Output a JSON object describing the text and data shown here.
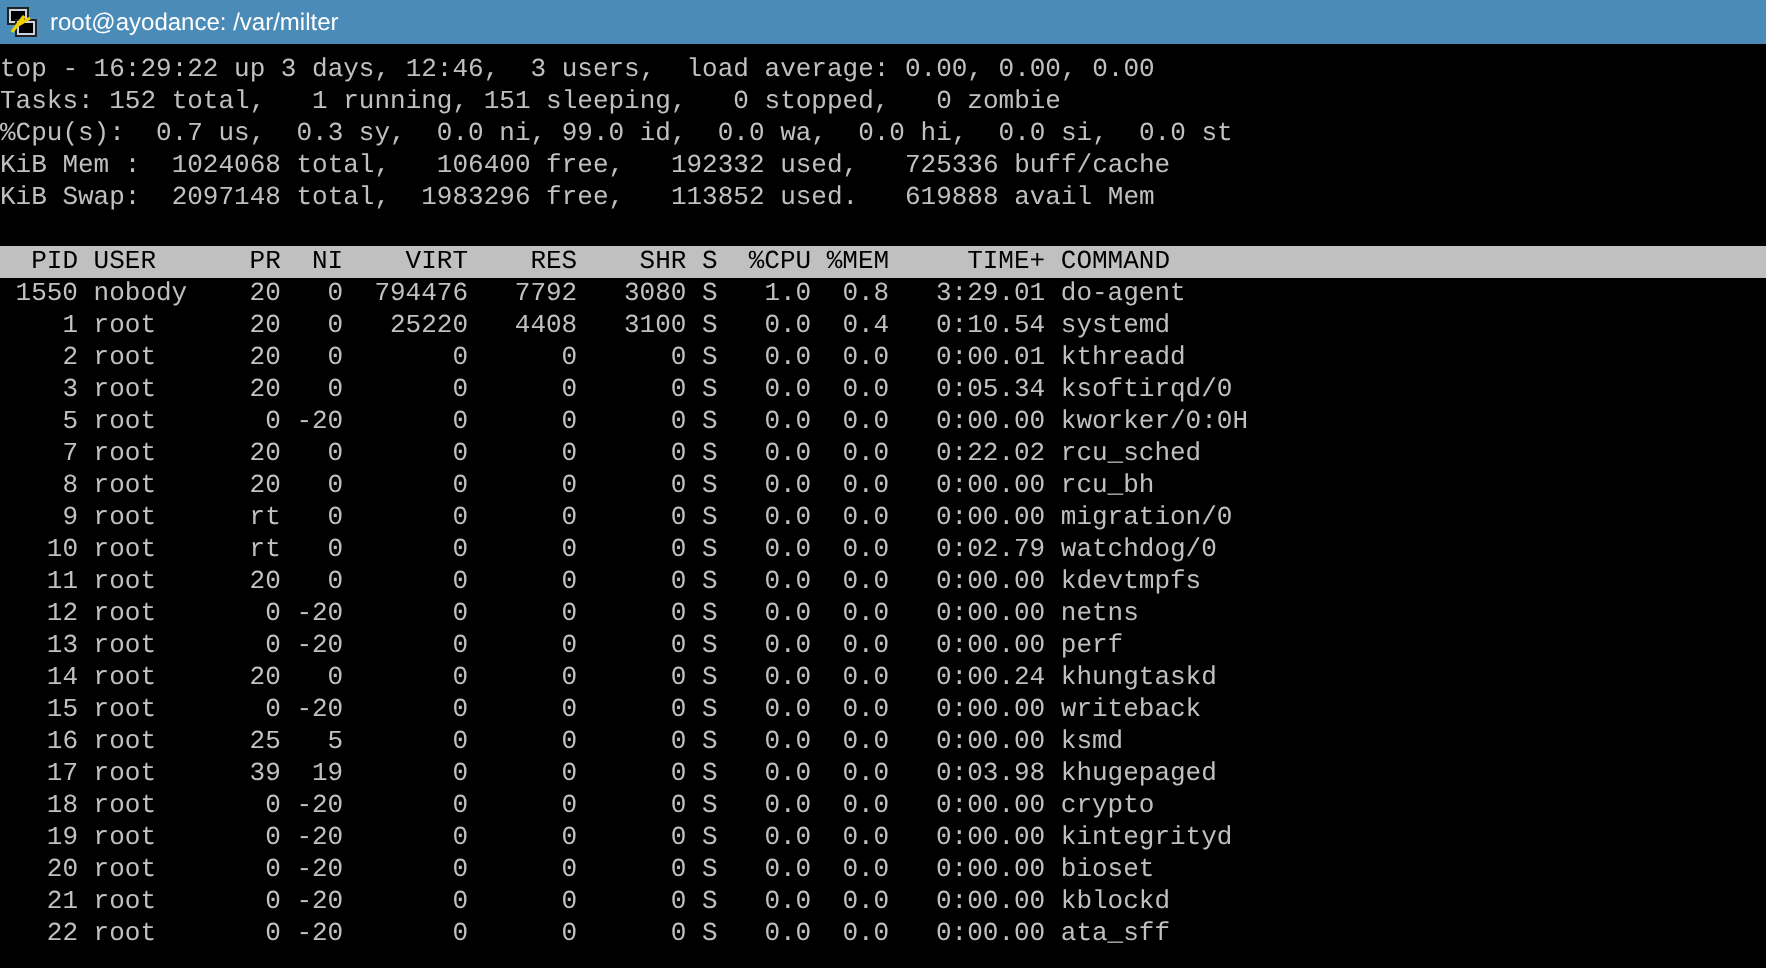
{
  "window": {
    "title": "root@ayodance: /var/milter"
  },
  "summary": [
    "top - 16:29:22 up 3 days, 12:46,  3 users,  load average: 0.00, 0.00, 0.00",
    "Tasks: 152 total,   1 running, 151 sleeping,   0 stopped,   0 zombie",
    "%Cpu(s):  0.7 us,  0.3 sy,  0.0 ni, 99.0 id,  0.0 wa,  0.0 hi,  0.0 si,  0.0 st",
    "KiB Mem :  1024068 total,   106400 free,   192332 used,   725336 buff/cache",
    "KiB Swap:  2097148 total,  1983296 free,   113852 used.   619888 avail Mem"
  ],
  "table": {
    "columns": [
      "PID",
      "USER",
      "PR",
      "NI",
      "VIRT",
      "RES",
      "SHR",
      "S",
      "%CPU",
      "%MEM",
      "TIME+",
      "COMMAND"
    ],
    "rows": [
      [
        "1550",
        "nobody",
        "20",
        "0",
        "794476",
        "7792",
        "3080",
        "S",
        "1.0",
        "0.8",
        "3:29.01",
        "do-agent"
      ],
      [
        "1",
        "root",
        "20",
        "0",
        "25220",
        "4408",
        "3100",
        "S",
        "0.0",
        "0.4",
        "0:10.54",
        "systemd"
      ],
      [
        "2",
        "root",
        "20",
        "0",
        "0",
        "0",
        "0",
        "S",
        "0.0",
        "0.0",
        "0:00.01",
        "kthreadd"
      ],
      [
        "3",
        "root",
        "20",
        "0",
        "0",
        "0",
        "0",
        "S",
        "0.0",
        "0.0",
        "0:05.34",
        "ksoftirqd/0"
      ],
      [
        "5",
        "root",
        "0",
        "-20",
        "0",
        "0",
        "0",
        "S",
        "0.0",
        "0.0",
        "0:00.00",
        "kworker/0:0H"
      ],
      [
        "7",
        "root",
        "20",
        "0",
        "0",
        "0",
        "0",
        "S",
        "0.0",
        "0.0",
        "0:22.02",
        "rcu_sched"
      ],
      [
        "8",
        "root",
        "20",
        "0",
        "0",
        "0",
        "0",
        "S",
        "0.0",
        "0.0",
        "0:00.00",
        "rcu_bh"
      ],
      [
        "9",
        "root",
        "rt",
        "0",
        "0",
        "0",
        "0",
        "S",
        "0.0",
        "0.0",
        "0:00.00",
        "migration/0"
      ],
      [
        "10",
        "root",
        "rt",
        "0",
        "0",
        "0",
        "0",
        "S",
        "0.0",
        "0.0",
        "0:02.79",
        "watchdog/0"
      ],
      [
        "11",
        "root",
        "20",
        "0",
        "0",
        "0",
        "0",
        "S",
        "0.0",
        "0.0",
        "0:00.00",
        "kdevtmpfs"
      ],
      [
        "12",
        "root",
        "0",
        "-20",
        "0",
        "0",
        "0",
        "S",
        "0.0",
        "0.0",
        "0:00.00",
        "netns"
      ],
      [
        "13",
        "root",
        "0",
        "-20",
        "0",
        "0",
        "0",
        "S",
        "0.0",
        "0.0",
        "0:00.00",
        "perf"
      ],
      [
        "14",
        "root",
        "20",
        "0",
        "0",
        "0",
        "0",
        "S",
        "0.0",
        "0.0",
        "0:00.24",
        "khungtaskd"
      ],
      [
        "15",
        "root",
        "0",
        "-20",
        "0",
        "0",
        "0",
        "S",
        "0.0",
        "0.0",
        "0:00.00",
        "writeback"
      ],
      [
        "16",
        "root",
        "25",
        "5",
        "0",
        "0",
        "0",
        "S",
        "0.0",
        "0.0",
        "0:00.00",
        "ksmd"
      ],
      [
        "17",
        "root",
        "39",
        "19",
        "0",
        "0",
        "0",
        "S",
        "0.0",
        "0.0",
        "0:03.98",
        "khugepaged"
      ],
      [
        "18",
        "root",
        "0",
        "-20",
        "0",
        "0",
        "0",
        "S",
        "0.0",
        "0.0",
        "0:00.00",
        "crypto"
      ],
      [
        "19",
        "root",
        "0",
        "-20",
        "0",
        "0",
        "0",
        "S",
        "0.0",
        "0.0",
        "0:00.00",
        "kintegrityd"
      ],
      [
        "20",
        "root",
        "0",
        "-20",
        "0",
        "0",
        "0",
        "S",
        "0.0",
        "0.0",
        "0:00.00",
        "bioset"
      ],
      [
        "21",
        "root",
        "0",
        "-20",
        "0",
        "0",
        "0",
        "S",
        "0.0",
        "0.0",
        "0:00.00",
        "kblockd"
      ],
      [
        "22",
        "root",
        "0",
        "-20",
        "0",
        "0",
        "0",
        "S",
        "0.0",
        "0.0",
        "0:00.00",
        "ata_sff"
      ]
    ]
  }
}
